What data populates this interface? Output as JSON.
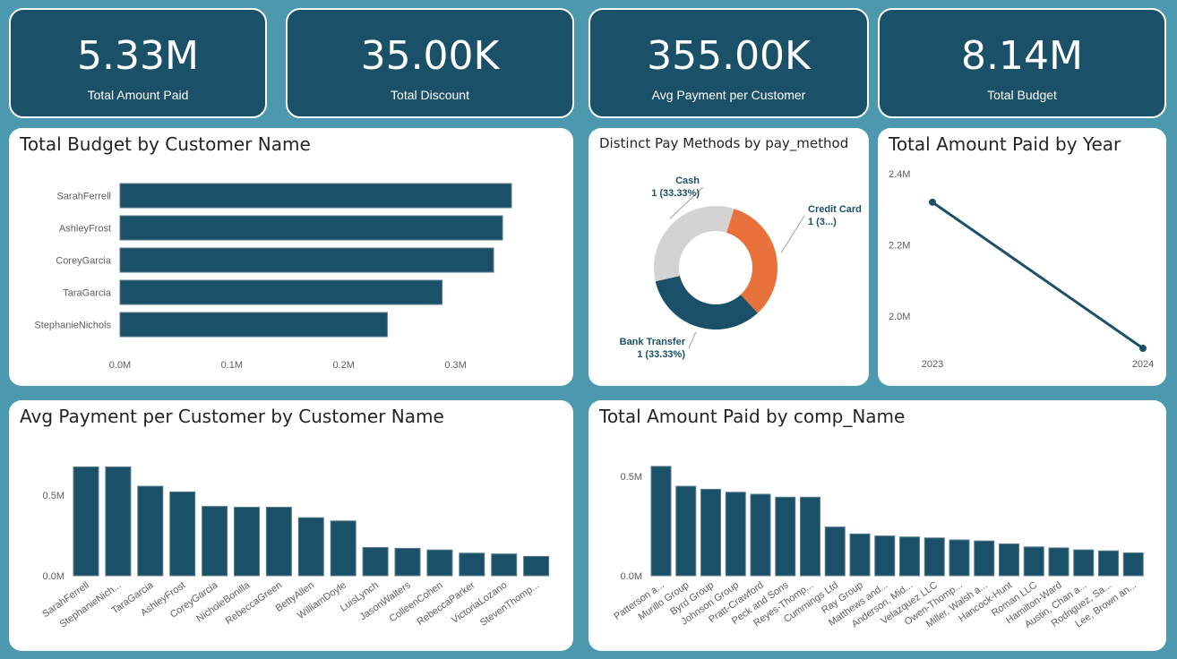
{
  "kpis": [
    {
      "value": "5.33M",
      "label": "Total Amount Paid"
    },
    {
      "value": "35.00K",
      "label": "Total Discount"
    },
    {
      "value": "355.00K",
      "label": "Avg Payment per Customer"
    },
    {
      "value": "8.14M",
      "label": "Total Budget"
    }
  ],
  "panels": {
    "budget_title": "Total Budget by Customer Name",
    "paymethod_title": "Distinct Pay Methods by pay_method",
    "year_title": "Total Amount Paid by Year",
    "avgpay_title": "Avg Payment per Customer by Customer Name",
    "comp_title": "Total Amount Paid by comp_Name"
  },
  "colors": {
    "accent": "#1b5168",
    "orange": "#e8703a",
    "grey": "#d3d3d3",
    "background": "#4c98ae"
  },
  "chart_data": [
    {
      "type": "bar",
      "orientation": "horizontal",
      "title": "Total Budget by Customer Name",
      "categories": [
        "SarahFerrell",
        "AshleyFrost",
        "CoreyGarcia",
        "TaraGarcia",
        "StephanieNichols"
      ],
      "values": [
        0.35,
        0.342,
        0.334,
        0.288,
        0.239
      ],
      "xticks": [
        "0.0M",
        "0.1M",
        "0.2M",
        "0.3M"
      ],
      "xlim": [
        0,
        0.35
      ]
    },
    {
      "type": "pie",
      "title": "Distinct Pay Methods by pay_method",
      "slices": [
        {
          "label": "Credit Card",
          "value": 1,
          "text": "1 (3...)",
          "color": "#e8703a"
        },
        {
          "label": "Bank Transfer",
          "value": 1,
          "text": "1 (33.33%)",
          "color": "#1b5168"
        },
        {
          "label": "Cash",
          "value": 1,
          "text": "1 (33.33%)",
          "color": "#d3d3d3"
        }
      ]
    },
    {
      "type": "line",
      "title": "Total Amount Paid by Year",
      "x": [
        "2023",
        "2024"
      ],
      "values": [
        2.32,
        1.91
      ],
      "yticks": [
        "2.4M",
        "2.2M",
        "2.0M"
      ],
      "ylim": [
        1.9,
        2.4
      ]
    },
    {
      "type": "bar",
      "title": "Avg Payment per Customer by Customer Name",
      "categories": [
        "SarahFerrell",
        "StephanieNich...",
        "TaraGarcia",
        "AshleyFrost",
        "CoreyGarcia",
        "NicholeBonilla",
        "RebeccaGreen",
        "BettyAllen",
        "WilliamDoyle",
        "LuisLynch",
        "JasonWalters",
        "ColleenCohen",
        "RebeccaParker",
        "VictoriaLozano",
        "StevenThomp..."
      ],
      "values": [
        0.675,
        0.675,
        0.555,
        0.52,
        0.43,
        0.425,
        0.425,
        0.36,
        0.34,
        0.175,
        0.17,
        0.16,
        0.14,
        0.135,
        0.12
      ],
      "yticks": [
        "0.5M",
        "0.0M"
      ],
      "ylim": [
        0,
        0.7
      ]
    },
    {
      "type": "bar",
      "title": "Total Amount Paid by comp_Name",
      "categories": [
        "Patterson a...",
        "Murillo Group",
        "Byrd Group",
        "Johnson Group",
        "Pratt-Crawford",
        "Peck and Sons",
        "Reyes-Thomp...",
        "Cummings Ltd",
        "Ray Group",
        "Matthews and...",
        "Anderson, Mid...",
        "Velazquez LLC",
        "Owen-Thomp...",
        "Miller, Walsh a...",
        "Hancock-Hunt",
        "Roman LLC",
        "Hamilton-Ward",
        "Austin, Chan a...",
        "Rodriguez, Sa...",
        "Lee, Brown an..."
      ],
      "values": [
        0.55,
        0.45,
        0.435,
        0.42,
        0.41,
        0.395,
        0.395,
        0.245,
        0.21,
        0.2,
        0.195,
        0.19,
        0.18,
        0.175,
        0.16,
        0.145,
        0.14,
        0.13,
        0.125,
        0.115
      ],
      "yticks": [
        "0.5M",
        "0.0M"
      ],
      "ylim": [
        0,
        0.6
      ]
    }
  ]
}
